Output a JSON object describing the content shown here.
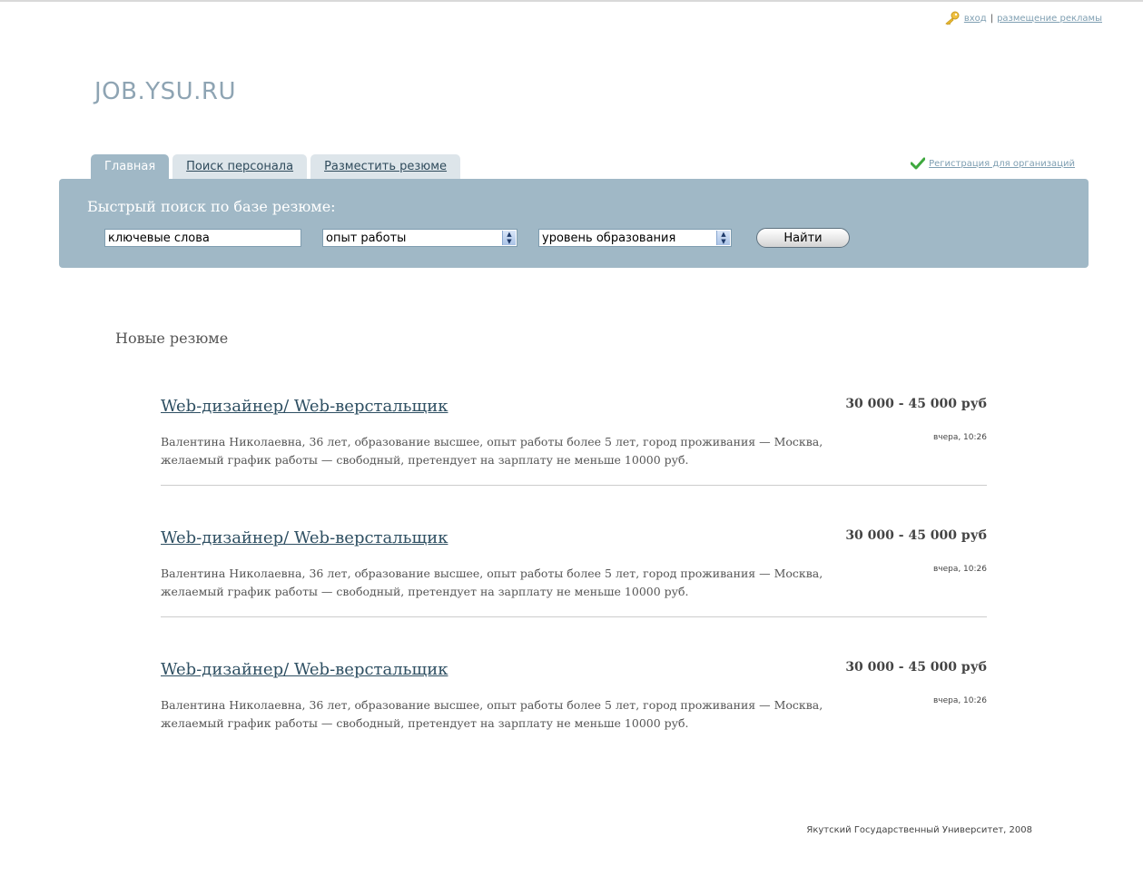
{
  "header": {
    "login": "вход",
    "separator": "|",
    "ads": "размещение рекламы",
    "logo": "JOB.YSU.RU"
  },
  "tabs": [
    {
      "label": "Главная",
      "active": true
    },
    {
      "label": "Поиск персонала",
      "active": false
    },
    {
      "label": "Разместить резюме",
      "active": false
    }
  ],
  "registration_link": "Регистрация для организаций",
  "search": {
    "title": "Быстрый поиск по базе резюме:",
    "keywords_value": "ключевые слова",
    "experience_value": "опыт работы",
    "education_value": "уровень образования",
    "button_label": "Найти"
  },
  "section_title": "Новые резюме",
  "resumes": [
    {
      "title": "Web-дизайнер/ Web-верстальщик",
      "salary": "30 000 - 45 000 руб",
      "date": "вчера, 10:26",
      "description": "Валентина Николаевна, 36 лет, образование высшее, опыт работы более 5 лет, город проживания — Москва, желаемый график работы — свободный, претендует на зарплату не меньше 10000 руб."
    },
    {
      "title": "Web-дизайнер/ Web-верстальщик",
      "salary": "30 000 - 45 000 руб",
      "date": "вчера, 10:26",
      "description": "Валентина Николаевна, 36 лет, образование высшее, опыт работы более 5 лет, город проживания — Москва, желаемый график работы — свободный, претендует на зарплату не меньше 10000 руб."
    },
    {
      "title": "Web-дизайнер/ Web-верстальщик",
      "salary": "30 000 - 45 000 руб",
      "date": "вчера, 10:26",
      "description": "Валентина Николаевна, 36 лет, образование высшее, опыт работы более 5 лет, город проживания — Москва, желаемый график работы — свободный, претендует на зарплату не меньше 10000 руб."
    }
  ],
  "footer": "Якутский Государственный Университет, 2008",
  "colors": {
    "accent": "#a0b8c6",
    "tab_inactive": "#dde5ea",
    "logo": "#8ea4b3",
    "link": "#2e4f62"
  }
}
